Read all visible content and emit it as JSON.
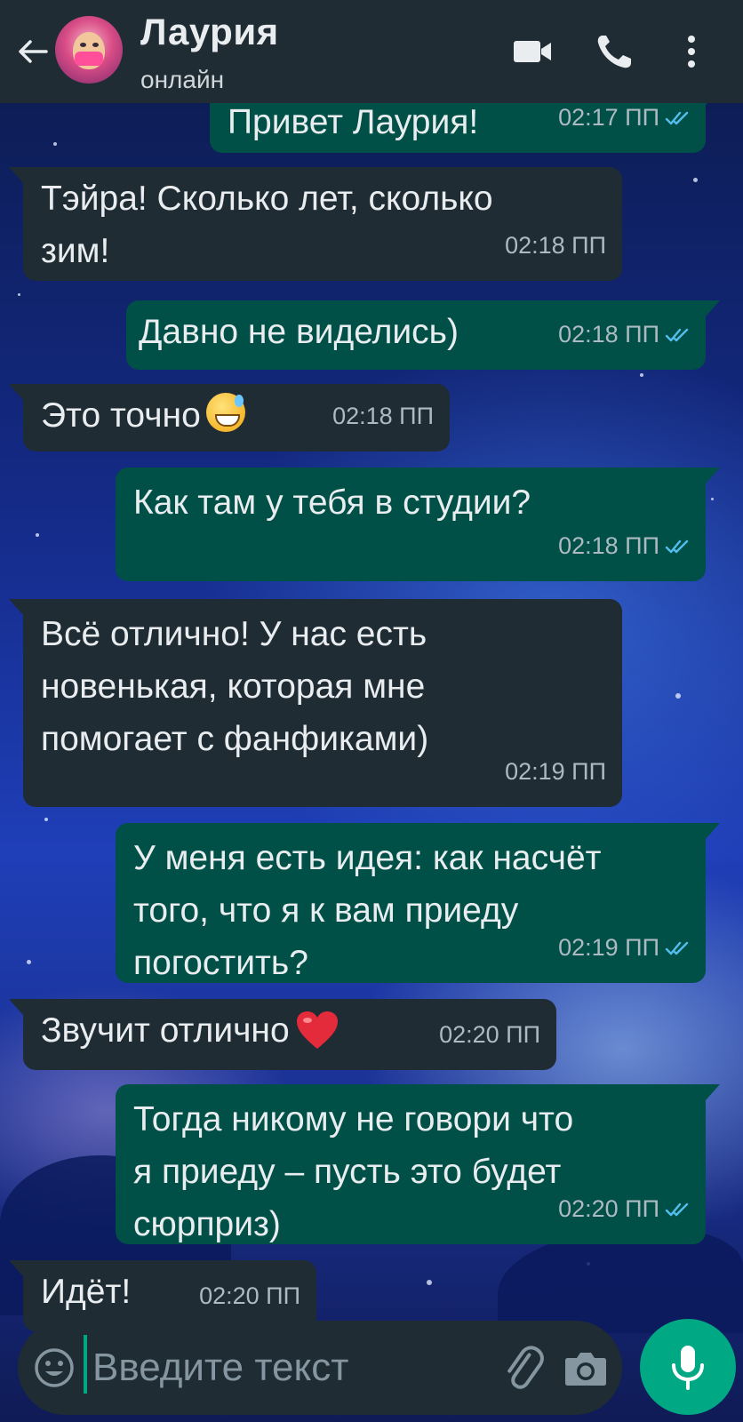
{
  "header": {
    "contact_name": "Лаурия",
    "status": "онлайн"
  },
  "messages": [
    {
      "direction": "out",
      "text": "Привет Лаурия!",
      "time": "02:17 ПП",
      "read": true
    },
    {
      "direction": "in",
      "text": "Тэйра! Сколько лет, сколько\nзим!",
      "time": "02:18 ПП"
    },
    {
      "direction": "out",
      "text": "Давно не виделись)",
      "time": "02:18 ПП",
      "read": true
    },
    {
      "direction": "in",
      "text": "Это точно",
      "emoji": "grinning-sweat-emoji",
      "time": "02:18 ПП"
    },
    {
      "direction": "out",
      "text": "Как там у тебя в студии?",
      "time": "02:18 ПП",
      "read": true
    },
    {
      "direction": "in",
      "text": "Всё отлично! У нас есть\nновенькая, которая мне\nпомогает с фанфиками)",
      "time": "02:19 ПП"
    },
    {
      "direction": "out",
      "text": "У меня есть идея: как насчёт\nтого, что я к вам приеду\nпогостить?",
      "time": "02:19 ПП",
      "read": true
    },
    {
      "direction": "in",
      "text": "Звучит отлично",
      "emoji": "red-heart-emoji",
      "time": "02:20 ПП"
    },
    {
      "direction": "out",
      "text": "Тогда никому не говори что\nя приеду – пусть это будет\nсюрприз)",
      "time": "02:20 ПП",
      "read": true
    },
    {
      "direction": "in",
      "text": "Идёт!",
      "time": "02:20 ПП"
    }
  ],
  "composer": {
    "placeholder": "Введите текст"
  },
  "colors": {
    "header_bg": "#1f2c34",
    "incoming_bubble": "#1f2c34",
    "outgoing_bubble": "#005048",
    "accent": "#00a884",
    "read_tick": "#53bdeb"
  }
}
